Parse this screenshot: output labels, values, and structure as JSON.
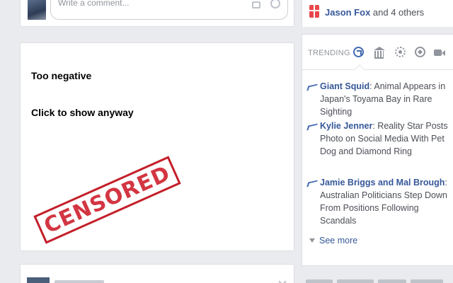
{
  "comment": {
    "placeholder": "Write a comment..."
  },
  "censor": {
    "heading": "Too negative",
    "action_label": "Click to show anyway",
    "stamp_text": "CENSORED",
    "stamp_color": "#d02432"
  },
  "friends": {
    "name": "Jason Fox",
    "suffix": " and 4 others"
  },
  "trending": {
    "label": "TRENDING",
    "categories": [
      "top-trends",
      "politics",
      "science-technology",
      "sports",
      "entertainment"
    ],
    "items": [
      {
        "title": "Giant Squid",
        "text": ": Animal Appears in Japan's Toyama Bay in Rare Sighting"
      },
      {
        "title": "Kylie Jenner",
        "text": ": Reality Star Posts Photo on Social Media With Pet Dog and Diamond Ring"
      },
      {
        "title": "Jamie Briggs and Mal Brough",
        "text": ": Australian Politicians Step Down From Positions Following Scandals"
      }
    ],
    "see_more": "See more"
  },
  "colors": {
    "link": "#365899",
    "accent": "#4267b2",
    "background": "#e9ebee"
  }
}
